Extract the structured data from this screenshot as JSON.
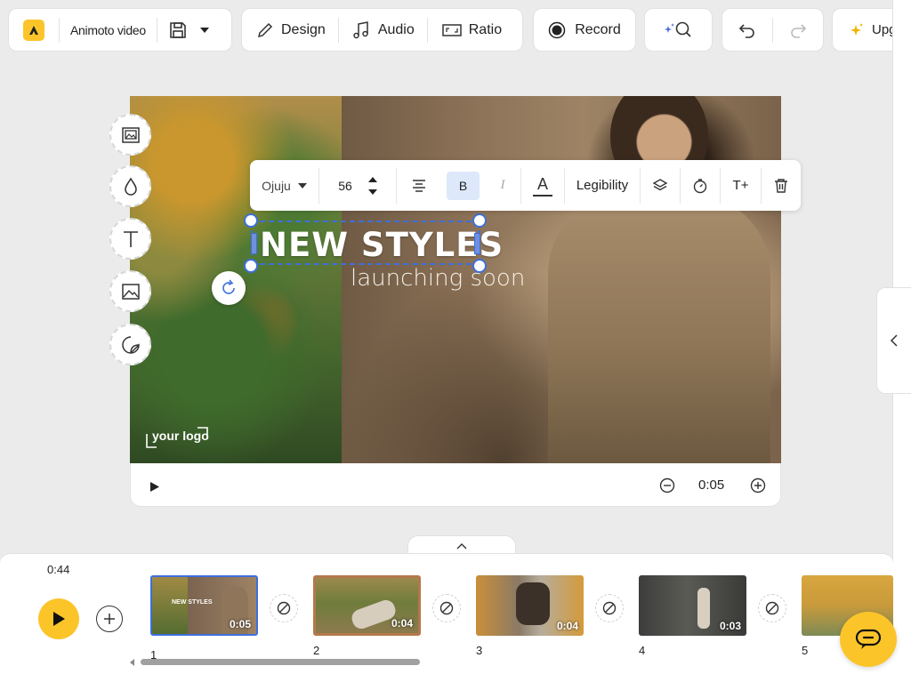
{
  "toolbar": {
    "project_name": "Animoto video",
    "design_label": "Design",
    "audio_label": "Audio",
    "ratio_label": "Ratio",
    "record_label": "Record",
    "upgrade_label": "Upg"
  },
  "video": {
    "title": "NEW STYLES",
    "subtitle": "launching soon",
    "logo_text": "your logo"
  },
  "text_toolbar": {
    "font": "Ojuju",
    "size": "56",
    "bold_label": "B",
    "italic_label": "I",
    "color_label": "A",
    "legibility_label": "Legibility",
    "add_text_label": "T+"
  },
  "canvas_controls": {
    "duration": "0:05"
  },
  "timeline": {
    "total_time": "0:44",
    "scenes": [
      {
        "number": "1",
        "duration": "0:05",
        "thumb_title": "NEW STYLES"
      },
      {
        "number": "2",
        "duration": "0:04"
      },
      {
        "number": "3",
        "duration": "0:04"
      },
      {
        "number": "4",
        "duration": "0:03"
      },
      {
        "number": "5",
        "duration": ""
      }
    ]
  },
  "colors": {
    "accent": "#fbc52a",
    "selection": "#3d6fdc"
  }
}
